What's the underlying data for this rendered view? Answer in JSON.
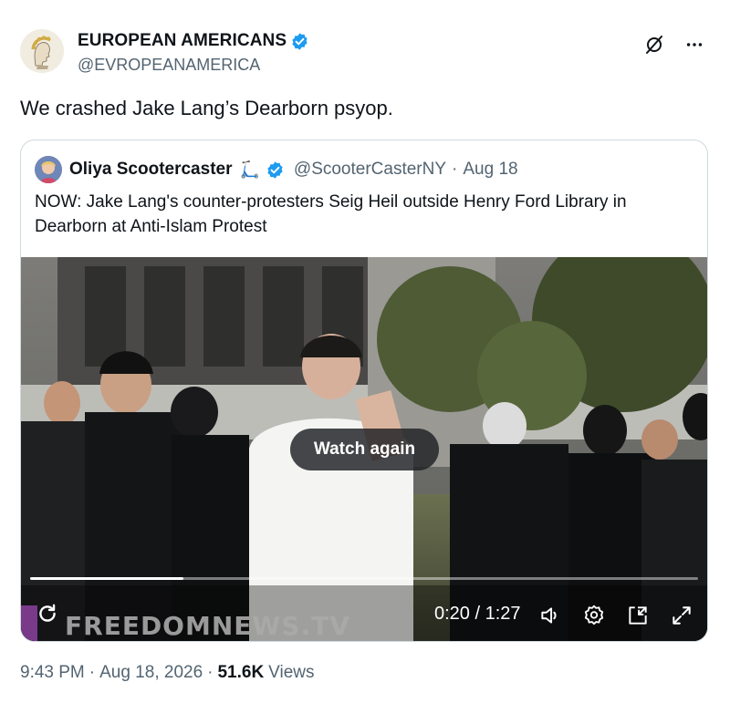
{
  "author": {
    "display_name": "EUROPEAN AMERICANS",
    "handle": "@EVROPEANAMERICA",
    "avatar_icon": "laurel-bust-icon",
    "verified_color": "#1d9bf0"
  },
  "top_actions": {
    "grok_icon": "grok-icon",
    "more_icon": "more-dots-icon"
  },
  "tweet": {
    "text": "We crashed Jake Lang’s Dearborn psyop."
  },
  "quote": {
    "display_name": "Oliya Scootercaster",
    "name_emoji": "🛴",
    "handle": "@ScooterCasterNY",
    "separator": "·",
    "date": "Aug 18",
    "text": "NOW: Jake Lang's counter-protesters Seig Heil outside Henry Ford Library in Dearborn at Anti-Islam Protest",
    "video": {
      "watch_again_label": "Watch again",
      "watermark": "FREEDOMNEWS.TV",
      "current_time": "0:20",
      "duration": "1:27",
      "time_display": "0:20 / 1:27",
      "progress_fraction": 0.23,
      "controls": [
        "replay-icon",
        "volume-icon",
        "settings-icon",
        "pip-icon",
        "fullscreen-icon"
      ]
    }
  },
  "footer": {
    "time": "9:43 PM",
    "sep1": "·",
    "date": "Aug 18, 2026",
    "sep2": "·",
    "views_count": "51.6K",
    "views_label": "Views"
  }
}
